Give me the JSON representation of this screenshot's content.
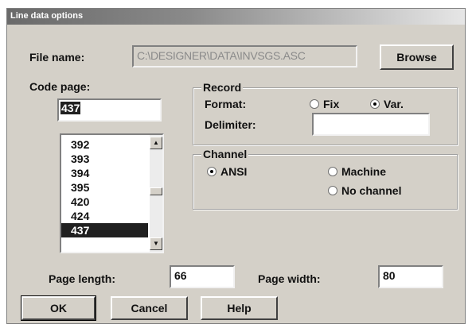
{
  "window": {
    "title": "Line data options"
  },
  "file_name": {
    "label": "File name:",
    "value": "C:\\DESIGNER\\DATA\\INVSGS.ASC"
  },
  "browse_button": {
    "label": "Browse"
  },
  "code_page": {
    "label": "Code page:",
    "value": "437",
    "options": [
      "392",
      "393",
      "394",
      "395",
      "420",
      "424",
      "437"
    ],
    "selected": "437"
  },
  "record": {
    "title": "Record",
    "format_label": "Format:",
    "fix_label": "Fix",
    "var_label": "Var.",
    "selected_format": "Var.",
    "delimiter_label": "Delimiter:",
    "delimiter_value": ""
  },
  "channel": {
    "title": "Channel",
    "ansi_label": "ANSI",
    "machine_label": "Machine",
    "no_channel_label": "No channel",
    "selected": "ANSI"
  },
  "page_length": {
    "label": "Page length:",
    "value": "66"
  },
  "page_width": {
    "label": "Page width:",
    "value": "80"
  },
  "buttons": {
    "ok": "OK",
    "cancel": "Cancel",
    "help": "Help"
  },
  "icons": {
    "scroll_up": "scroll-up-arrow",
    "scroll_down": "scroll-down-arrow"
  }
}
